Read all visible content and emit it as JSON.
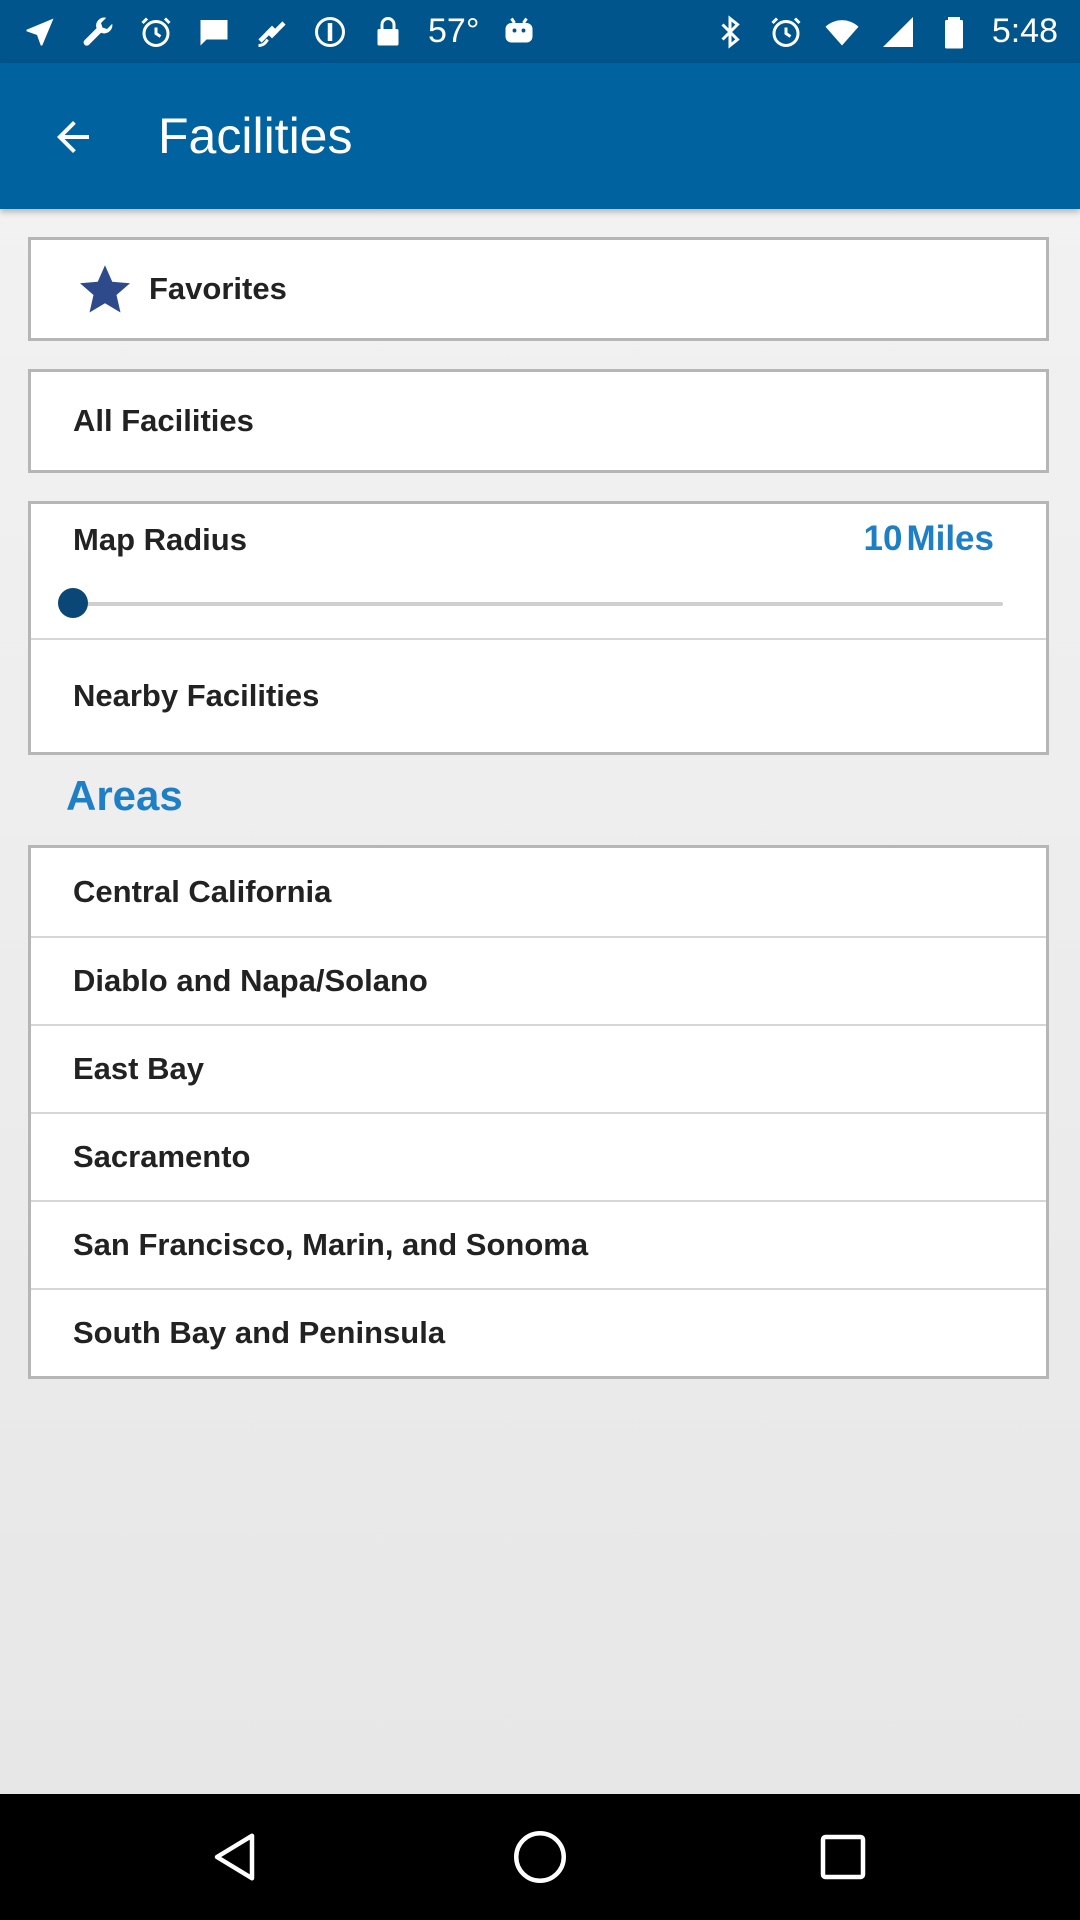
{
  "status_bar": {
    "temperature": "57°",
    "time": "5:48",
    "left_icons": [
      "navigation-icon",
      "wrench-icon",
      "alarm-icon",
      "message-icon",
      "fake-gps-icon",
      "sync-icon",
      "lock-icon"
    ],
    "right_icons": [
      "bluetooth-icon",
      "alarm-icon",
      "wifi-icon",
      "signal-icon",
      "battery-icon"
    ]
  },
  "app_bar": {
    "title": "Facilities",
    "back_icon": "arrow-left-icon"
  },
  "colors": {
    "app_bar": "#00629e",
    "status_bar": "#00558d",
    "accent": "#1f7fc5",
    "star": "#2e4a8b",
    "slider_thumb": "#0a4777"
  },
  "favorites": {
    "label": "Favorites",
    "icon": "star-icon"
  },
  "all_facilities": {
    "label": "All Facilities"
  },
  "map_radius": {
    "label": "Map Radius",
    "value": "10",
    "unit": "Miles",
    "slider_fraction": 0
  },
  "nearby": {
    "label": "Nearby Facilities"
  },
  "areas": {
    "title": "Areas",
    "items": [
      "Central California",
      "Diablo and Napa/Solano",
      "East Bay",
      "Sacramento",
      "San Francisco, Marin, and Sonoma",
      "South Bay and Peninsula"
    ]
  },
  "nav_bar": {
    "icons": [
      "back-triangle-icon",
      "home-circle-icon",
      "recents-square-icon"
    ]
  }
}
